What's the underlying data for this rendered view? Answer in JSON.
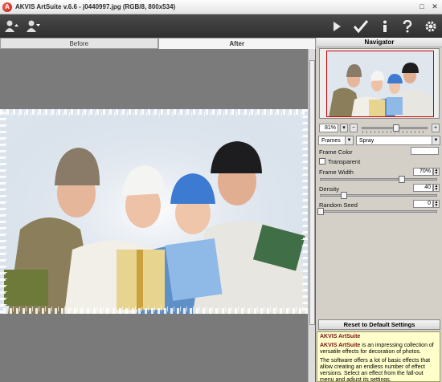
{
  "window": {
    "title": "AKVIS ArtSuite v.6.6 - j0440997.jpg (RGB/8, 800x534)",
    "logo_letter": "A",
    "controls": [
      "□",
      "✕"
    ]
  },
  "toolbar": {
    "left_icons": [
      "open-image-icon",
      "save-image-icon"
    ],
    "right_icons": [
      "run-icon",
      "apply-icon",
      "info-icon",
      "help-icon",
      "settings-icon"
    ]
  },
  "tabs": [
    {
      "label": "Before",
      "active": false
    },
    {
      "label": "After",
      "active": true
    }
  ],
  "navigator": {
    "title": "Navigator",
    "zoom": "81%",
    "zoom_minus": "−",
    "zoom_plus": "+"
  },
  "effect": {
    "category": "Frames",
    "type": "Spray"
  },
  "params": {
    "frame_color_label": "Frame Color",
    "transparent_label": "Transparent",
    "frame_width_label": "Frame Width",
    "frame_width_value": "70%",
    "frame_width_level": 0.7,
    "density_label": "Density",
    "density_value": "40",
    "density_level": 0.2,
    "seed_label": "Random Seed",
    "seed_value": "0",
    "seed_level": 0.0
  },
  "reset_label": "Reset to Default Settings",
  "help": {
    "title": "AKVIS ArtSuite",
    "brand": "AKVIS ArtSuite",
    "p1": " is an impressing collection of versatile effects for decoration of photos.",
    "p2": "The software offers a lot of basic effects that allow creating an endless number of effect versions. Select an effect from the fall-out menu and adjust its settings."
  }
}
